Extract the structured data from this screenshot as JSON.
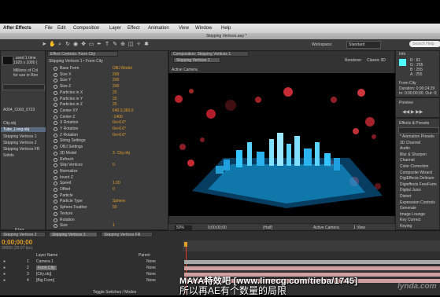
{
  "menu": {
    "app": "After Effects",
    "items": [
      "File",
      "Edit",
      "Composition",
      "Layer",
      "Effect",
      "Animation",
      "View",
      "Window",
      "Help"
    ]
  },
  "window_title": "Skipping Vertices.aep *",
  "toolbar": {
    "workspace_label": "Workspace:",
    "workspace_value": "Standard",
    "search_placeholder": "Search Help"
  },
  "project": {
    "info_line1": ", used 1 time",
    "info_line2": "1920 x 1080 (",
    "info_line3": "Millions of Col",
    "info_line4": "for use in Ren",
    "items": [
      "A004_C003_0723",
      "City.obj",
      "Tube_Long.obj",
      "Skipping Vertices 1",
      "Skipping Vertices 2",
      "Skipping Vertices FR",
      "Solids"
    ],
    "bpc": "8 bpc"
  },
  "effect_controls": {
    "tab": "Effect Controls: Form City",
    "subtitle": "Skipping Vertices 1 • Form City",
    "rows": [
      {
        "label": "Base Form",
        "value": "OBJ Model"
      },
      {
        "label": "Size X",
        "value": "200"
      },
      {
        "label": "Size Y",
        "value": "200"
      },
      {
        "label": "Size Z",
        "value": "200"
      },
      {
        "label": "Particles in X",
        "value": "25"
      },
      {
        "label": "Particles in Y",
        "value": "25"
      },
      {
        "label": "Particles in Z",
        "value": "25"
      },
      {
        "label": "Center XY",
        "value": "640.0,360.0"
      },
      {
        "label": "Center Z",
        "value": "-1400"
      },
      {
        "label": "X Rotation",
        "value": "0x+0.0°"
      },
      {
        "label": "Y Rotation",
        "value": "0x+0.0°"
      },
      {
        "label": "Z Rotation",
        "value": "0x+0.0°"
      },
      {
        "label": "String Settings",
        "value": ""
      },
      {
        "label": "OBJ Settings",
        "value": ""
      },
      {
        "label": "3D Model",
        "value": "3. City.obj"
      },
      {
        "label": "Refresh",
        "value": ""
      },
      {
        "label": "Skip Vertices",
        "value": "0"
      },
      {
        "label": "Normalize",
        "value": ""
      },
      {
        "label": "Invert Z",
        "value": ""
      },
      {
        "label": "Speed",
        "value": "1.00"
      },
      {
        "label": "Offset",
        "value": "0"
      },
      {
        "label": "Particle",
        "value": ""
      },
      {
        "label": "Particle Type",
        "value": "Sphere"
      },
      {
        "label": "Sphere Feather",
        "value": "50"
      },
      {
        "label": "Texture",
        "value": ""
      },
      {
        "label": "Rotation",
        "value": ""
      },
      {
        "label": "Size",
        "value": "1"
      }
    ]
  },
  "composition": {
    "tab": "Composition: Skipping Vertices 1",
    "subtab": "Skipping Vertices 1",
    "renderer_label": "Renderer:",
    "renderer_value": "Classic 3D",
    "active_camera": "Active Camera",
    "zoom": "50%",
    "timecode": "0;00;00;00",
    "resolution": "(Half)",
    "view": "Active Camera",
    "views": "1 View"
  },
  "info": {
    "tab": "Info",
    "r": "R :  81",
    "g": "G :  255",
    "b": "B :  255",
    "a": "A :  255",
    "layer": "Form City",
    "duration": "Duration: 0;00;24;29",
    "in_out": "In: 0;00;00;00, Out: 0;"
  },
  "preview_tab": "Preview",
  "effects_presets": {
    "tab": "Effects & Presets",
    "items": [
      "* Animation Presets",
      "3D Channel",
      "Audio",
      "Blur & Sharpen",
      "Channel",
      "Color Correction",
      "Composite Wizard",
      "DigiEffects Delirium",
      "Digieffects FreeForm",
      "Digital Juice",
      "Distort",
      "Expression Controls",
      "Generate",
      "Image Lounge",
      "Key Correct",
      "Keying"
    ]
  },
  "timeline": {
    "tabs": [
      "Skipping Vertices 2",
      "Skipping Vertices 1",
      "Skipping Vertices FR"
    ],
    "timecode": "0;00;00;00",
    "fps": "00000 (29.97 fps)",
    "header_name": "Layer Name",
    "header_parent": "Parent",
    "layers": [
      {
        "num": "1",
        "name": "Camera 1",
        "parent": "None"
      },
      {
        "num": "2",
        "name": "Form City",
        "parent": "None"
      },
      {
        "num": "3",
        "name": "[City.obj]",
        "parent": "None"
      },
      {
        "num": "4",
        "name": "[Big Form]",
        "parent": "None"
      }
    ],
    "footer": "Toggle Switches / Modes"
  },
  "subtitle_en": "MAYA特效吧 [www.linecg.com/tieba/1745]",
  "subtitle_cn": "所以再AE有个数量的局限",
  "watermark": "lynda.com"
}
